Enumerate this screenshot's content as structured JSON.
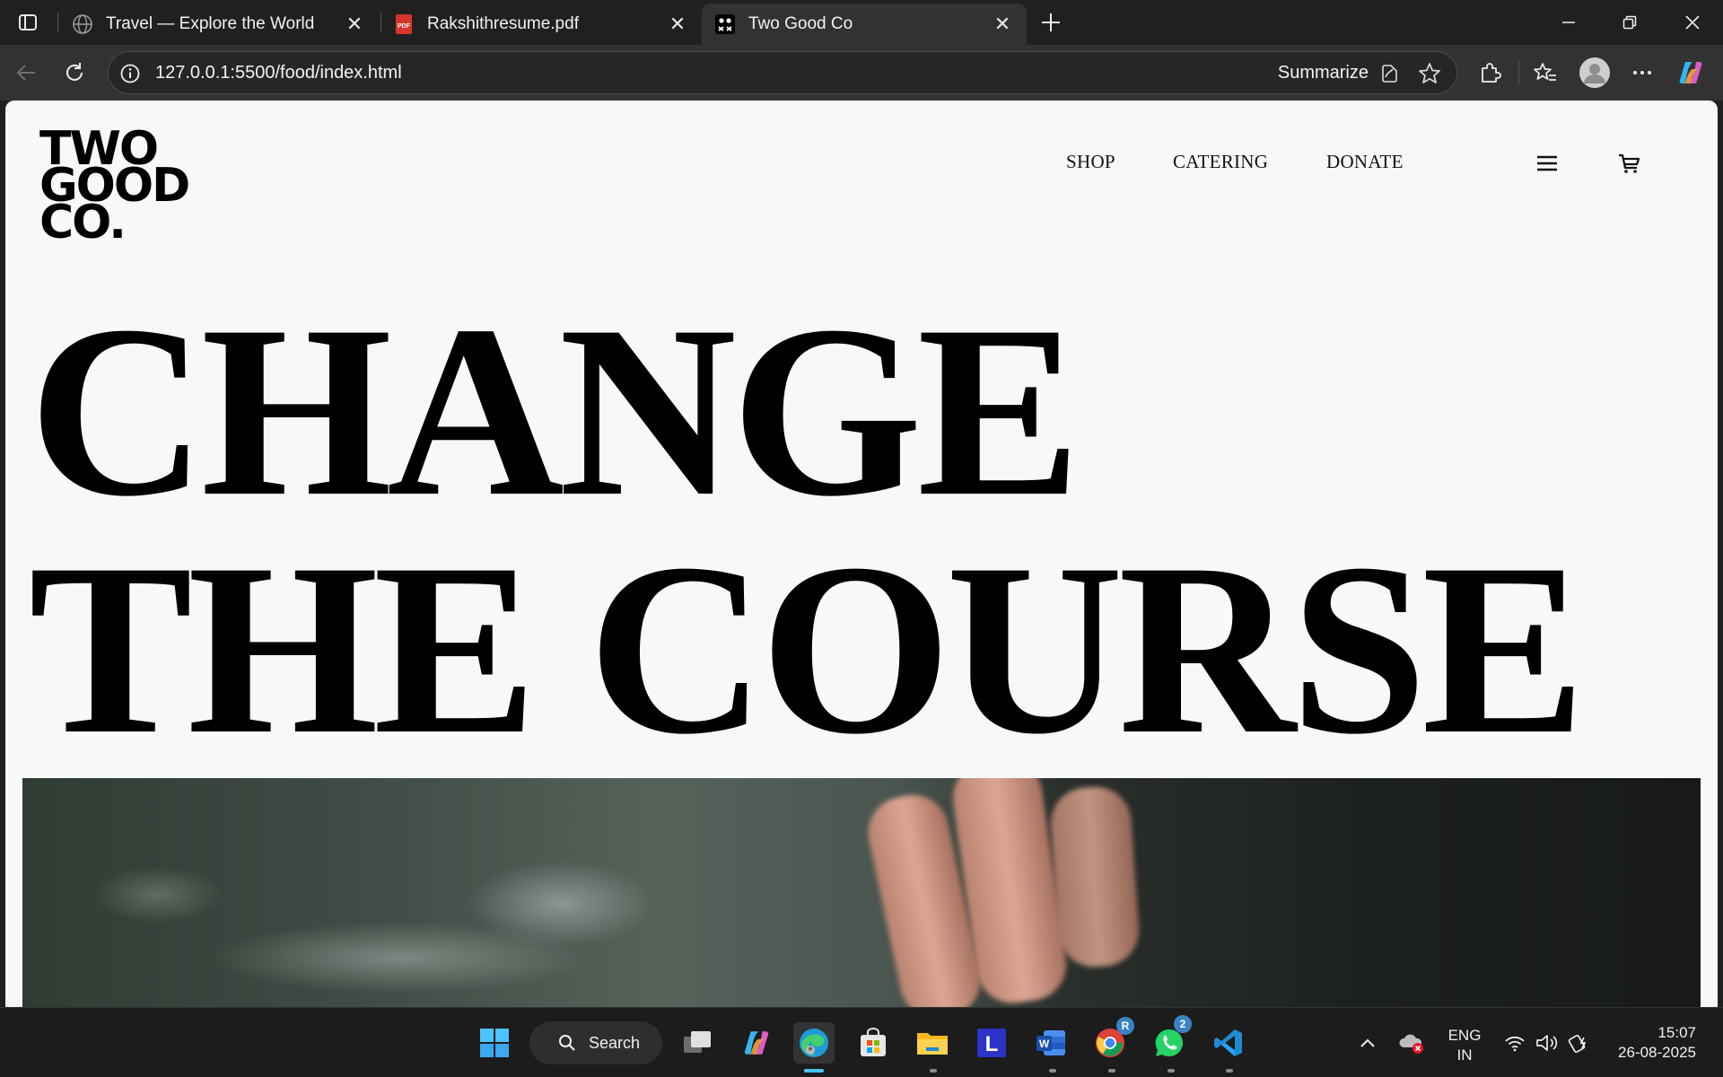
{
  "browser": {
    "tabs": [
      {
        "title": "Travel — Explore the World",
        "icon": "globe-icon",
        "active": false
      },
      {
        "title": "Rakshithresume.pdf",
        "icon": "pdf-icon",
        "active": false
      },
      {
        "title": "Two Good Co",
        "icon": "two-good-favicon",
        "active": true
      }
    ],
    "address": "127.0.0.1:5500/food/index.html",
    "summarize_label": "Summarize"
  },
  "site": {
    "logo_lines": [
      "TWO",
      "GOOD",
      "CO."
    ],
    "nav": [
      "SHOP",
      "CATERING",
      "DONATE"
    ],
    "hero_lines": [
      "CHANGE",
      "THE COURSE"
    ]
  },
  "taskbar": {
    "search_label": "Search",
    "whatsapp_badge": "2",
    "chrome_badge": "R",
    "language_line1": "ENG",
    "language_line2": "IN",
    "time": "15:07",
    "date": "26-08-2025"
  },
  "colors": {
    "chrome_bg": "#202020",
    "toolbar_bg": "#323232",
    "page_bg": "#f8f8f8",
    "taskbar_bg": "#1c1c1c",
    "accent_blue": "#4cc2ff"
  }
}
